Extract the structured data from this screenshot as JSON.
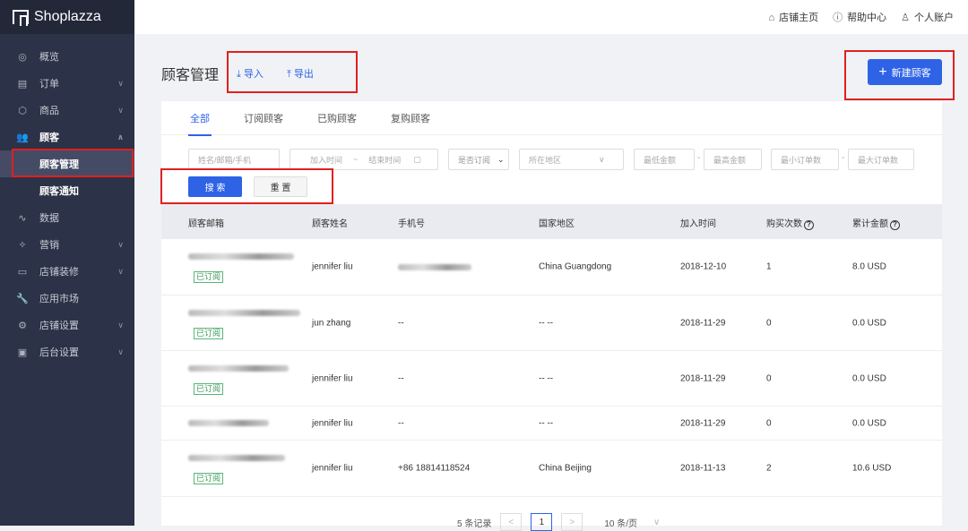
{
  "app": {
    "brand": "Shoplazza"
  },
  "sidebar": {
    "items": [
      {
        "label": "概览",
        "icon": "dashboard-icon",
        "glyph": "◎"
      },
      {
        "label": "订单",
        "icon": "order-icon",
        "glyph": "▤",
        "chev": "∨"
      },
      {
        "label": "商品",
        "icon": "box-icon",
        "glyph": "⬡",
        "chev": "∨"
      },
      {
        "label": "顾客",
        "icon": "users-icon",
        "glyph": "👥",
        "chev": "∧"
      },
      {
        "label": "顾客管理"
      },
      {
        "label": "顾客通知"
      },
      {
        "label": "数据",
        "icon": "chart-icon",
        "glyph": "∿"
      },
      {
        "label": "营销",
        "icon": "megaphone-icon",
        "glyph": "✧",
        "chev": "∨"
      },
      {
        "label": "店铺装修",
        "icon": "layout-icon",
        "glyph": "▭",
        "chev": "∨"
      },
      {
        "label": "应用市场",
        "icon": "wrench-icon",
        "glyph": "🔧"
      },
      {
        "label": "店铺设置",
        "icon": "gear-icon",
        "glyph": "⚙",
        "chev": "∨"
      },
      {
        "label": "后台设置",
        "icon": "monitor-icon",
        "glyph": "▣",
        "chev": "∨"
      }
    ]
  },
  "topbar": {
    "home": "店铺主页",
    "help": "帮助中心",
    "account": "个人账户"
  },
  "page": {
    "title": "顾客管理",
    "import": "导入",
    "export": "导出",
    "new_customer": "新建顾客"
  },
  "tabs": [
    "全部",
    "订阅顾客",
    "已购顾客",
    "复购顾客"
  ],
  "filters": {
    "name_ph": "姓名/邮箱/手机",
    "start_ph": "加入时间",
    "tilde": "~",
    "end_ph": "结束时间",
    "subscribed_ph": "是否订阅",
    "region_ph": "所在地区",
    "min_amount_ph": "最低金额",
    "max_amount_ph": "最高金额",
    "min_orders_ph": "最小订单数",
    "max_orders_ph": "最大订单数",
    "dash": "-",
    "search": "搜 索",
    "reset": "重 置"
  },
  "table": {
    "headers": [
      "顾客邮箱",
      "顾客姓名",
      "手机号",
      "国家地区",
      "加入时间",
      "购买次数",
      "累计金额"
    ],
    "rows": [
      {
        "badge": "已订阅",
        "name": "jennifer liu",
        "phone": "",
        "region": "China Guangdong",
        "date": "2018-12-10",
        "count": "1",
        "amount": "8.0 USD"
      },
      {
        "badge": "已订阅",
        "name": "jun zhang",
        "phone": "--",
        "region": "-- --",
        "date": "2018-11-29",
        "count": "0",
        "amount": "0.0 USD"
      },
      {
        "badge": "已订阅",
        "name": "jennifer liu",
        "phone": "--",
        "region": "-- --",
        "date": "2018-11-29",
        "count": "0",
        "amount": "0.0 USD"
      },
      {
        "badge": "",
        "name": "jennifer liu",
        "phone": "--",
        "region": "-- --",
        "date": "2018-11-29",
        "count": "0",
        "amount": "0.0 USD"
      },
      {
        "badge": "已订阅",
        "name": "jennifer liu",
        "phone": "+86 18814118524",
        "region": "China Beijing",
        "date": "2018-11-13",
        "count": "2",
        "amount": "10.6 USD"
      }
    ]
  },
  "pagination": {
    "total": "5 条记录",
    "prev": "<",
    "page": "1",
    "next": ">",
    "per_page": "10 条/页",
    "chev": "∨"
  },
  "colors": {
    "accent": "#2f63e6",
    "sidebar": "#2c3247",
    "annotation": "#e02020"
  }
}
